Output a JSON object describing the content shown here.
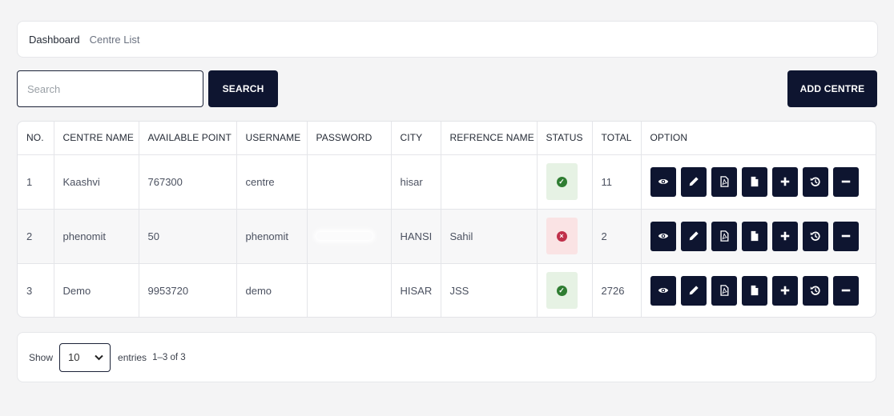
{
  "breadcrumb": {
    "home": "Dashboard",
    "current": "Centre List"
  },
  "search": {
    "placeholder": "Search",
    "value": "",
    "button_label": "SEARCH"
  },
  "add_button_label": "ADD CENTRE",
  "table": {
    "headers": [
      "NO.",
      "CENTRE NAME",
      "AVAILABLE POINT",
      "USERNAME",
      "PASSWORD",
      "CITY",
      "REFRENCE NAME",
      "STATUS",
      "TOTAL",
      "OPTION"
    ],
    "rows": [
      {
        "no": "1",
        "centre_name": "Kaashvi",
        "available_point": "767300",
        "username": "centre",
        "password": "",
        "city": "hisar",
        "reference_name": "",
        "status": "active",
        "total": "11"
      },
      {
        "no": "2",
        "centre_name": "phenomit",
        "available_point": "50",
        "username": "phenomit",
        "password": "",
        "city": "HANSI",
        "reference_name": "Sahil",
        "status": "inactive",
        "total": "2"
      },
      {
        "no": "3",
        "centre_name": "Demo",
        "available_point": "9953720",
        "username": "demo",
        "password": "",
        "city": "HISAR",
        "reference_name": "JSS",
        "status": "active",
        "total": "2726"
      }
    ],
    "option_icons": [
      "eye-icon",
      "pencil-icon",
      "pdf-icon",
      "document-icon",
      "plus-icon",
      "history-icon",
      "minus-icon"
    ]
  },
  "footer": {
    "show_label": "Show",
    "page_size": "10",
    "entries_label": "entries",
    "range_label": "1–3 of 3"
  },
  "colors": {
    "primary": "#0e1530",
    "active_bg": "#e6f2e4",
    "active_dot": "#2f7d32",
    "inactive_bg": "#fae3e4",
    "inactive_dot": "#c0304a"
  }
}
